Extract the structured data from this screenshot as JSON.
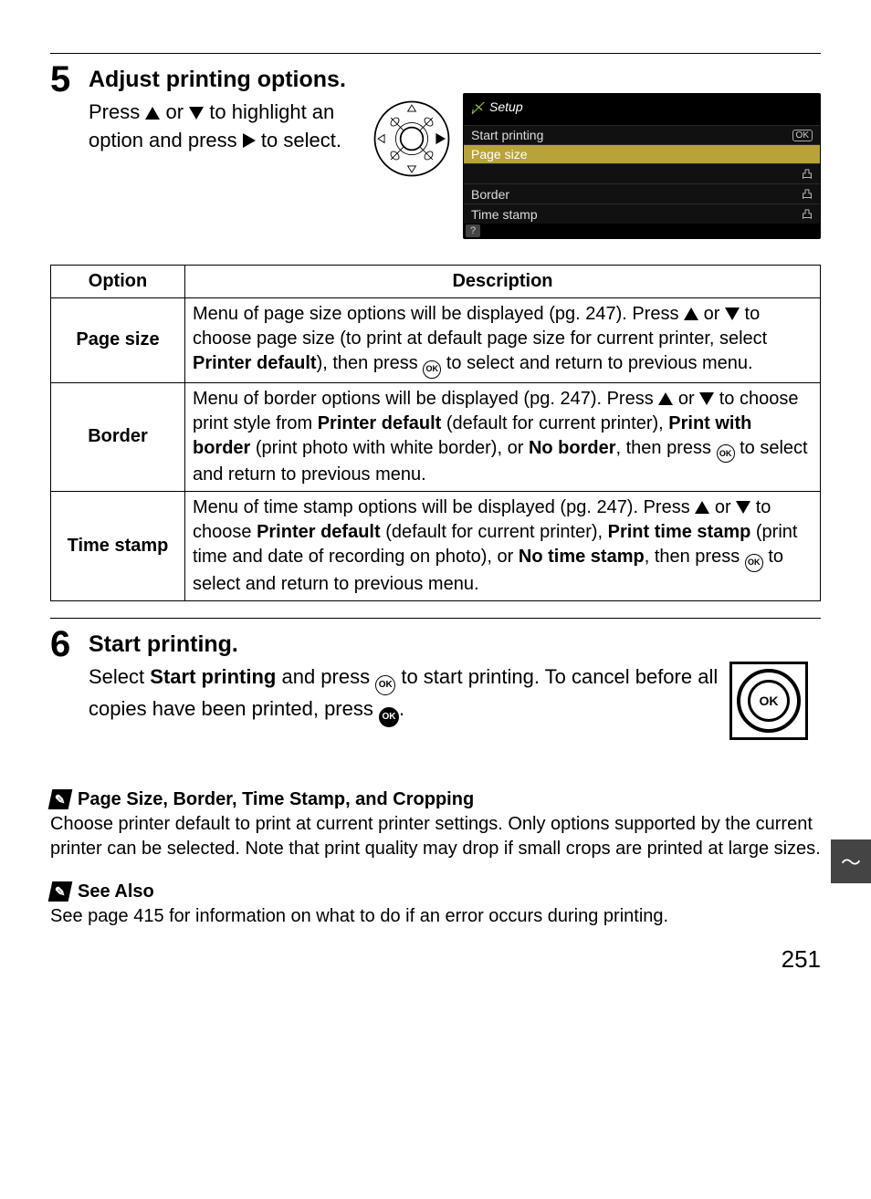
{
  "step5": {
    "number": "5",
    "heading": "Adjust printing options.",
    "body_pre": "Press ",
    "body_mid": " or ",
    "body_post1": " to highlight an option and press ",
    "body_post2": " to select."
  },
  "lcd": {
    "title": "Setup",
    "rows": [
      {
        "label": "Start printing",
        "badge": "OK"
      },
      {
        "label": "Page size",
        "highlight": true
      },
      {
        "label": "",
        "lock": true
      },
      {
        "label": "Border",
        "lock": true
      },
      {
        "label": "Time stamp",
        "lock": true
      }
    ]
  },
  "table": {
    "head_option": "Option",
    "head_desc": "Description",
    "rows": [
      {
        "option": "Page size",
        "d1": "Menu of page size options will be displayed (pg. 247). Press ",
        "d2": " or ",
        "d3": " to choose page size (to print at default page size for current printer, select ",
        "b1": "Printer default",
        "d4": "), then press ",
        "d5": " to select and return to previous menu."
      },
      {
        "option": "Border",
        "d1": "Menu of border options will be displayed (pg. 247).  Press ",
        "d2": " or ",
        "d3": " to choose print style from ",
        "b1": "Printer default",
        "d4": " (default for current printer), ",
        "b2": "Print with border",
        "d5": " (print photo with white border), or ",
        "b3": "No border",
        "d6": ", then press ",
        "d7": " to select and return to previous menu."
      },
      {
        "option": "Time stamp",
        "d1": "Menu of time stamp options will be displayed (pg. 247). Press ",
        "d2": " or ",
        "d3": " to choose ",
        "b1": "Printer default",
        "d4": " (default for current printer), ",
        "b2": "Print time stamp",
        "d5": " (print time and date of recording on photo), or ",
        "b3": "No time stamp",
        "d6": ", then press ",
        "d7": " to select and return to previous menu."
      }
    ]
  },
  "step6": {
    "number": "6",
    "heading": "Start printing.",
    "t1": "Select  ",
    "b1": "Start printing",
    "t2": " and press ",
    "t3": " to start printing. To cancel before all copies have been printed, press ",
    "t4": ".",
    "ok_label": "OK"
  },
  "note1": {
    "heading": "Page Size, Border, Time Stamp, and Cropping",
    "body": "Choose printer default to print at current printer settings.  Only options supported by the current printer can be selected.  Note that print quality may drop if small crops are printed at large sizes."
  },
  "note2": {
    "heading": "See Also",
    "body": "See page 415 for information on what to do if an error occurs during printing."
  },
  "page_number": "251"
}
